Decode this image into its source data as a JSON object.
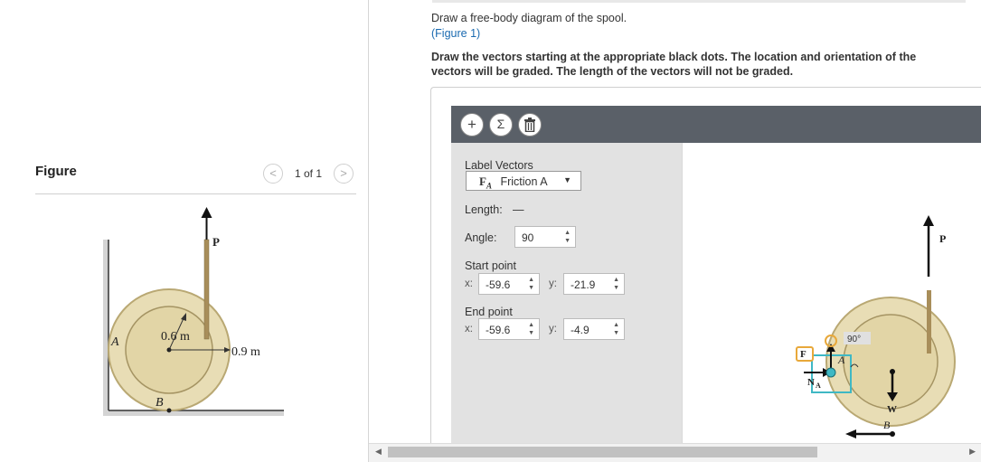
{
  "figure_panel": {
    "title": "Figure",
    "pager_text": "1 of 1",
    "prev_glyph": "<",
    "next_glyph": ">",
    "labels": {
      "force_p": "P",
      "point_a": "A",
      "point_b": "B",
      "inner_radius": "0.6 m",
      "outer_radius": "0.9 m"
    }
  },
  "question": {
    "instruction": "Draw a free-body diagram of the spool.",
    "figure_link": "(Figure 1)",
    "grading_note": "Draw the vectors starting at the appropriate black dots. The location and orientation of the vectors will be graded. The length of the vectors will not be graded."
  },
  "toolbar": {
    "add_glyph": "+",
    "sum_glyph": "Σ",
    "delete_icon": "trash-icon"
  },
  "vector_panel": {
    "label_vectors_title": "Label Vectors",
    "selected_symbol": "F",
    "selected_subscript": "A",
    "selected_label": "Friction A",
    "length_label": "Length:",
    "length_value": "—",
    "angle_label": "Angle:",
    "angle_value": "90",
    "start_point_label": "Start point",
    "end_point_label": "End point",
    "x_label": "x:",
    "y_label": "y:",
    "start_x": "-59.6",
    "start_y": "-21.9",
    "end_x": "-59.6",
    "end_y": "-4.9"
  },
  "canvas_labels": {
    "p": "P",
    "w": "W",
    "b": "B",
    "f": "F",
    "n": "N",
    "sub_a": "A",
    "angle": "90°"
  },
  "colors": {
    "spool_fill": "#e8ddb5",
    "spool_stroke": "#b9a873",
    "rod": "#a88e5a",
    "selection_teal": "#3fb8c4",
    "label_orange": "#e8a83a",
    "toolbar_bg": "#5a6068",
    "link": "#1a6ab0"
  }
}
